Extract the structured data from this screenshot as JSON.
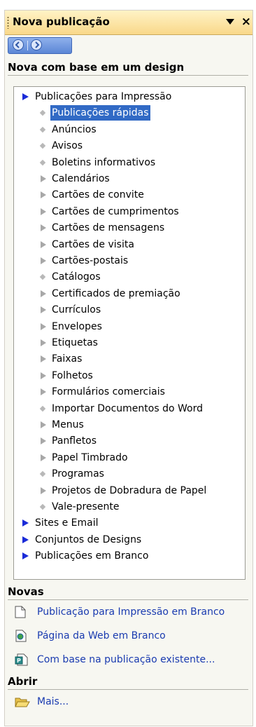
{
  "header": {
    "title": "Nova publicação"
  },
  "design_section": {
    "heading": "Nova com base em um design",
    "tree": [
      {
        "label": "Publicações para Impressão",
        "level": 0,
        "marker": "triangle-blue"
      },
      {
        "label": "Publicações rápidas",
        "level": 1,
        "marker": "dot",
        "selected": true
      },
      {
        "label": "Anúncios",
        "level": 1,
        "marker": "dot"
      },
      {
        "label": "Avisos",
        "level": 1,
        "marker": "dot"
      },
      {
        "label": "Boletins informativos",
        "level": 1,
        "marker": "dot"
      },
      {
        "label": "Calendários",
        "level": 1,
        "marker": "triangle-gray"
      },
      {
        "label": "Cartões de convite",
        "level": 1,
        "marker": "triangle-gray"
      },
      {
        "label": "Cartões de cumprimentos",
        "level": 1,
        "marker": "triangle-gray"
      },
      {
        "label": "Cartões de mensagens",
        "level": 1,
        "marker": "triangle-gray"
      },
      {
        "label": "Cartões de visita",
        "level": 1,
        "marker": "triangle-gray"
      },
      {
        "label": "Cartões-postais",
        "level": 1,
        "marker": "triangle-gray"
      },
      {
        "label": "Catálogos",
        "level": 1,
        "marker": "dot"
      },
      {
        "label": "Certificados de premiação",
        "level": 1,
        "marker": "triangle-gray"
      },
      {
        "label": "Currículos",
        "level": 1,
        "marker": "triangle-gray"
      },
      {
        "label": "Envelopes",
        "level": 1,
        "marker": "triangle-gray"
      },
      {
        "label": "Etiquetas",
        "level": 1,
        "marker": "triangle-gray"
      },
      {
        "label": "Faixas",
        "level": 1,
        "marker": "triangle-gray"
      },
      {
        "label": "Folhetos",
        "level": 1,
        "marker": "triangle-gray"
      },
      {
        "label": "Formulários comerciais",
        "level": 1,
        "marker": "triangle-gray"
      },
      {
        "label": "Importar Documentos do Word",
        "level": 1,
        "marker": "dot"
      },
      {
        "label": "Menus",
        "level": 1,
        "marker": "triangle-gray"
      },
      {
        "label": "Panfletos",
        "level": 1,
        "marker": "triangle-gray"
      },
      {
        "label": "Papel Timbrado",
        "level": 1,
        "marker": "triangle-gray"
      },
      {
        "label": "Programas",
        "level": 1,
        "marker": "dot"
      },
      {
        "label": "Projetos de Dobradura de Papel",
        "level": 1,
        "marker": "triangle-gray"
      },
      {
        "label": "Vale-presente",
        "level": 1,
        "marker": "dot"
      },
      {
        "label": "Sites e Email",
        "level": 0,
        "marker": "triangle-blue"
      },
      {
        "label": "Conjuntos de Designs",
        "level": 0,
        "marker": "triangle-blue"
      },
      {
        "label": "Publicações em Branco",
        "level": 0,
        "marker": "triangle-blue"
      }
    ]
  },
  "new_section": {
    "heading": "Novas",
    "items": [
      {
        "label": "Publicação para Impressão em Branco",
        "icon": "blank-page-icon"
      },
      {
        "label": "Página da Web em Branco",
        "icon": "web-page-icon"
      },
      {
        "label": "Com base na publicação existente...",
        "icon": "publisher-file-icon"
      }
    ]
  },
  "open_section": {
    "heading": "Abrir",
    "items": [
      {
        "label": "Mais...",
        "icon": "open-folder-icon"
      }
    ]
  },
  "colors": {
    "title_gradient_top": "#fff3c6",
    "title_gradient_bottom": "#f9d88a",
    "selection": "#316ac5",
    "link": "#1a3bb0",
    "tree_arrow": "#1a2bd8"
  }
}
